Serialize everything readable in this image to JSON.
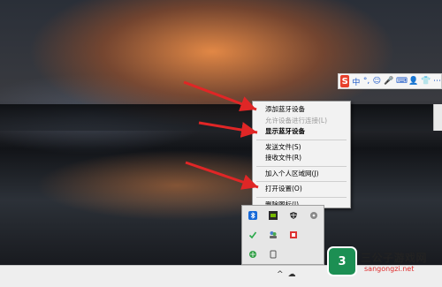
{
  "context_menu": {
    "items": [
      {
        "label": "添加蓝牙设备",
        "style": "normal"
      },
      {
        "label": "允许设备进行连接(L)",
        "style": "disabled"
      },
      {
        "label": "显示蓝牙设备",
        "style": "bold"
      },
      {
        "label": "发送文件(S)",
        "style": "normal"
      },
      {
        "label": "接收文件(R)",
        "style": "normal"
      },
      {
        "label": "加入个人区域网(J)",
        "style": "normal"
      },
      {
        "label": "打开设置(O)",
        "style": "normal"
      },
      {
        "label": "删除图标(I)",
        "style": "normal"
      }
    ]
  },
  "ime_bar": {
    "logo": "S",
    "items": [
      "中",
      "°,",
      "☺",
      "🎤",
      "⌨",
      "👤",
      "👕",
      "⋯"
    ]
  },
  "tray": {
    "icons": [
      "bluetooth-icon",
      "nvidia-icon",
      "shield-icon",
      "disk-icon",
      "check-icon",
      "people-icon",
      "app-icon",
      "flag-icon",
      "network-icon",
      "device-icon"
    ]
  },
  "watermark": {
    "logo_text": "3",
    "title": "三公子游戏网",
    "url": "sangongzi.net"
  },
  "colors": {
    "arrow": "#e02626",
    "menu_bg": "#f2f2f2",
    "ime_logo": "#e8402c",
    "watermark_green": "#1c8f53"
  }
}
